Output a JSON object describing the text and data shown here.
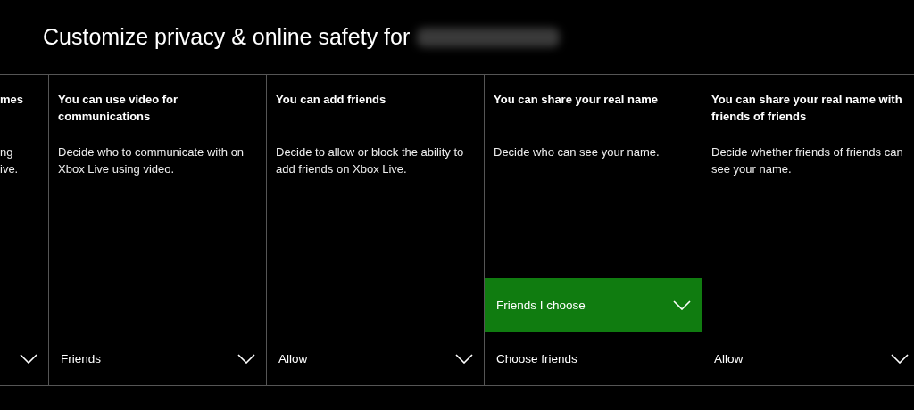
{
  "title": "Customize privacy & online safety for",
  "columns": [
    {
      "title": "mes",
      "description": "ng\nive.",
      "options": [
        {
          "kind": "dropdown",
          "selected": false
        }
      ]
    },
    {
      "title": "You can use video for communications",
      "description": "Decide who to communicate with on Xbox Live using video.",
      "options": [
        {
          "kind": "dropdown",
          "label": "Friends",
          "selected": false
        }
      ]
    },
    {
      "title": "You can add friends",
      "description": "Decide to allow or block the ability to add friends on Xbox Live.",
      "options": [
        {
          "kind": "dropdown",
          "label": "Allow",
          "selected": false
        }
      ]
    },
    {
      "title": "You can share your real name",
      "description": "Decide who can see your name.",
      "options": [
        {
          "kind": "dropdown",
          "label": "Friends I choose",
          "selected": true
        },
        {
          "kind": "button",
          "label": "Choose friends",
          "selected": false
        }
      ]
    },
    {
      "title": "You can share your real name with friends of friends",
      "description": "Decide whether friends of friends can see your name.",
      "options": [
        {
          "kind": "dropdown",
          "label": "Allow",
          "selected": false
        }
      ]
    }
  ]
}
